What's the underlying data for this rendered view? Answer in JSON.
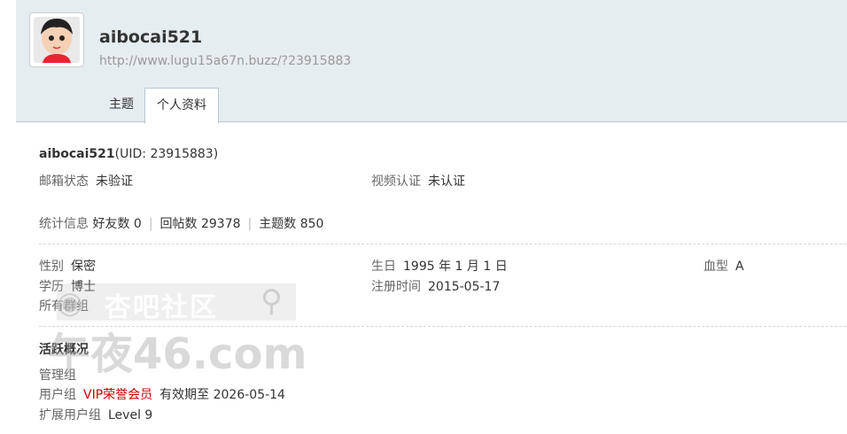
{
  "header": {
    "username": "aibocai521",
    "url": "http://www.lugu15a67n.buzz/?23915883",
    "tabs": [
      {
        "label": "主题",
        "active": false
      },
      {
        "label": "个人资料",
        "active": true
      }
    ]
  },
  "profile": {
    "name": "aibocai521",
    "uid_text": "(UID: 23915883)",
    "email_status": {
      "label": "邮箱状态",
      "value": "未验证"
    },
    "video_verify": {
      "label": "视频认证",
      "value": "未认证"
    },
    "stats": {
      "label": "统计信息",
      "friends": "好友数 0",
      "replies": "回帖数 29378",
      "threads": "主题数 850"
    },
    "gender": {
      "label": "性别",
      "value": "保密"
    },
    "birthday": {
      "label": "生日",
      "value": "1995 年 1 月 1 日"
    },
    "blood_type": {
      "label": "血型",
      "value": "A"
    },
    "education": {
      "label": "学历",
      "value": "博士"
    },
    "register_time": {
      "label": "注册时间",
      "value": "2015-05-17"
    },
    "groups": {
      "label": "所有群组"
    }
  },
  "activity": {
    "title": "活跃概况",
    "admin_group": {
      "label": "管理组"
    },
    "user_group": {
      "label": "用户组",
      "value": "VIP荣誉会员",
      "expiry": "有效期至 2026-05-14"
    },
    "ext_group": {
      "label": "扩展用户组",
      "value": "Level 9"
    }
  },
  "watermark": {
    "line1": "杏吧社区",
    "line2": "午夜46.com"
  },
  "colors": {
    "header_bg": "#e6edf0",
    "vip": "#cc0000",
    "border": "#b8c8d0"
  }
}
